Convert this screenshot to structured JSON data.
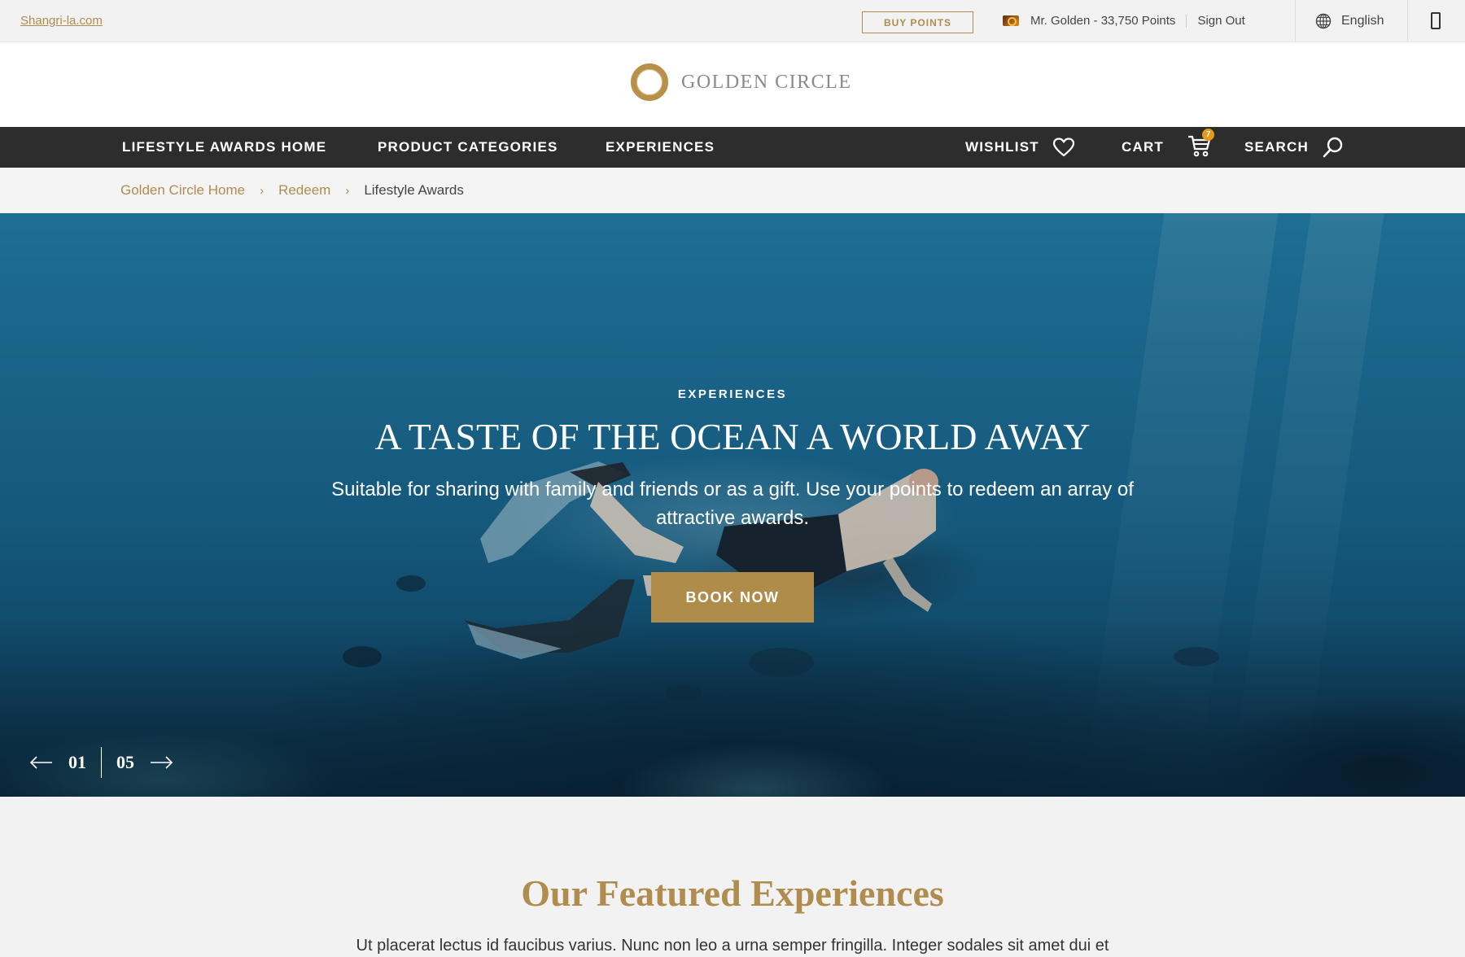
{
  "topbar": {
    "site_link": "Shangri-la.com",
    "buy_points": "BUY POINTS",
    "member": "Mr. Golden - 33,750 Points",
    "sign_out": "Sign Out",
    "language": "English"
  },
  "header": {
    "logo_text": "GOLDEN CIRCLE"
  },
  "nav": {
    "items": [
      {
        "label": "LIFESTYLE AWARDS HOME"
      },
      {
        "label": "PRODUCT CATEGORIES"
      },
      {
        "label": "EXPERIENCES"
      }
    ],
    "wishlist": "WISHLIST",
    "cart": "CART",
    "cart_count": "7",
    "search": "SEARCH"
  },
  "breadcrumb": {
    "items": [
      {
        "label": "Golden Circle Home"
      },
      {
        "label": "Redeem"
      }
    ],
    "current": "Lifestyle Awards",
    "separator": "›"
  },
  "hero": {
    "kicker": "EXPERIENCES",
    "title": "A TASTE OF THE OCEAN A WORLD AWAY",
    "description": "Suitable for sharing with family and friends or as a gift. Use your points to redeem an array of attractive awards.",
    "cta": "BOOK NOW",
    "current_slide": "01",
    "total_slides": "05"
  },
  "featured": {
    "title": "Our Featured Experiences",
    "text": "Ut placerat lectus id faucibus varius. Nunc non leo a urna semper fringilla. Integer sodales sit amet dui et"
  },
  "colors": {
    "gold": "#b08c4f",
    "nav_bg": "#2d2d2d",
    "cart_badge": "#e59a1a"
  }
}
